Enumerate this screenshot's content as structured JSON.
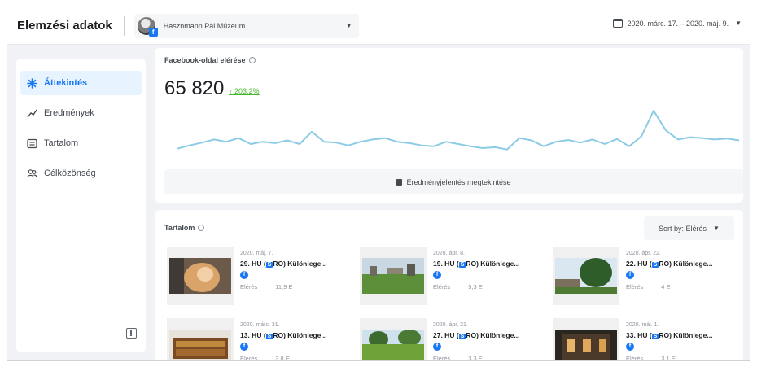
{
  "header": {
    "app_title": "Elemzési adatok",
    "page_name": "Hasznmann Pál Múzeum",
    "date_range": "2020. márc. 17. – 2020. máj. 9."
  },
  "sidebar": {
    "items": [
      {
        "label": "Áttekintés",
        "icon": "overview-icon",
        "active": true
      },
      {
        "label": "Eredmények",
        "icon": "results-icon",
        "active": false
      },
      {
        "label": "Tartalom",
        "icon": "content-icon",
        "active": false
      },
      {
        "label": "Célközönség",
        "icon": "audience-icon",
        "active": false
      }
    ]
  },
  "reach": {
    "title": "Facebook-oldal elérése",
    "value": "65 820",
    "change": "↑ 203,2%",
    "report_button": "Eredményjelentés megtekintése",
    "sparkline": [
      0.15,
      0.22,
      0.28,
      0.35,
      0.3,
      0.38,
      0.25,
      0.3,
      0.27,
      0.33,
      0.25,
      0.52,
      0.3,
      0.28,
      0.22,
      0.3,
      0.35,
      0.38,
      0.3,
      0.27,
      0.22,
      0.2,
      0.3,
      0.25,
      0.2,
      0.16,
      0.18,
      0.13,
      0.38,
      0.33,
      0.2,
      0.3,
      0.34,
      0.28,
      0.35,
      0.25,
      0.36,
      0.2,
      0.42,
      0.98,
      0.55,
      0.35,
      0.4,
      0.38,
      0.35,
      0.37,
      0.33
    ]
  },
  "content": {
    "title": "Tartalom",
    "sort_label": "Sort by: Elérés",
    "posts": [
      {
        "date": "2020. máj. 7.",
        "title_pre": "29. HU (",
        "flag": "S",
        "title_post": "RO) Különlege...",
        "metric_label": "Elérés",
        "metric_value": "11,9 E",
        "thumb": "cat"
      },
      {
        "date": "2020. ápr. 8.",
        "title_pre": "19. HU (",
        "flag": "S",
        "title_post": "RO) Különlege...",
        "metric_label": "Elérés",
        "metric_value": "5,3 E",
        "thumb": "park"
      },
      {
        "date": "2020. ápr. 22.",
        "title_pre": "22. HU (",
        "flag": "S",
        "title_post": "RO) Különlege...",
        "metric_label": "Elérés",
        "metric_value": "4 E",
        "thumb": "tree"
      },
      {
        "date": "2020. márc. 31.",
        "title_pre": "13. HU (",
        "flag": "S",
        "title_post": "RO) Különlege...",
        "metric_label": "Elérés",
        "metric_value": "3,8 E",
        "thumb": "chest"
      },
      {
        "date": "2020. ápr. 21.",
        "title_pre": "27. HU (",
        "flag": "S",
        "title_post": "RO) Különlege...",
        "metric_label": "Elérés",
        "metric_value": "3,3 E",
        "thumb": "lawn"
      },
      {
        "date": "2020. máj. 1.",
        "title_pre": "33. HU (",
        "flag": "S",
        "title_post": "RO) Különlege...",
        "metric_label": "Elérés",
        "metric_value": "3,1 E",
        "thumb": "night"
      }
    ]
  },
  "colors": {
    "accent": "#1877f2",
    "sparkline": "#8ccbe6",
    "positive": "#42b72a"
  }
}
